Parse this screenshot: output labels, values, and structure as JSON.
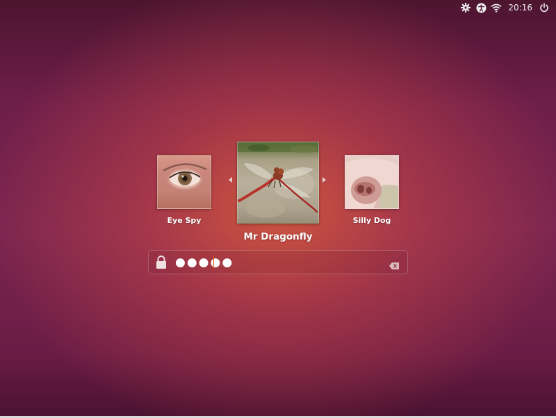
{
  "panel": {
    "time": "20:16",
    "icons": [
      "gear-icon",
      "accessibility-icon",
      "wifi-icon",
      "power-icon"
    ]
  },
  "users": [
    {
      "name": "Eye Spy",
      "avatar": "eye-closeup-photo"
    },
    {
      "name": "Mr Dragonfly",
      "avatar": "dragonfly-photo",
      "selected": true
    },
    {
      "name": "Silly Dog",
      "avatar": "dog-nose-photo"
    }
  ],
  "password": {
    "masked_value": "●●●●●",
    "icons": [
      "lock-icon",
      "clear-icon"
    ]
  },
  "colors": {
    "caret": "#e9541a"
  }
}
